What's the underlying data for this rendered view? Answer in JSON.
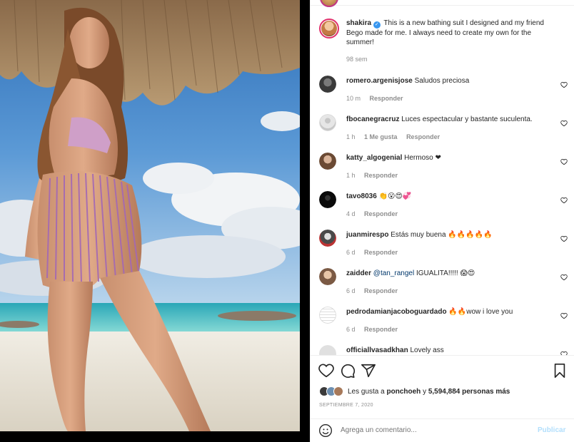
{
  "post": {
    "author": "shakira",
    "caption": "This is a new bathing suit I designed and my friend Bego made for me. I always need to create my own for the summer!",
    "age": "98 sem"
  },
  "comments": [
    {
      "user": "romero.argenisjose",
      "text": "Saludos preciosa",
      "time": "10 m",
      "likes": "",
      "reply": "Responder"
    },
    {
      "user": "fbocanegracruz",
      "text": "Luces espectacular y bastante suculenta.",
      "time": "1 h",
      "likes": "1 Me gusta",
      "reply": "Responder"
    },
    {
      "user": "katty_algogenial",
      "text": "Hermoso ❤",
      "time": "1 h",
      "likes": "",
      "reply": "Responder"
    },
    {
      "user": "tavo8036",
      "text": "👏😮😍💞",
      "time": "4 d",
      "likes": "",
      "reply": "Responder"
    },
    {
      "user": "juanmirespo",
      "text": "Estás muy buena 🔥🔥🔥🔥🔥",
      "time": "6 d",
      "likes": "",
      "reply": "Responder"
    },
    {
      "user": "zaidder",
      "mention": "@tan_rangel",
      "text": " IGUALITA!!!!! 😱😍",
      "time": "6 d",
      "likes": "",
      "reply": "Responder"
    },
    {
      "user": "pedrodamianjacoboguardado",
      "text": "🔥🔥wow i love you",
      "time": "6 d",
      "likes": "",
      "reply": "Responder"
    },
    {
      "user": "officiallvasadkhan",
      "text": "Lovely ass",
      "time": "",
      "likes": "",
      "reply": ""
    }
  ],
  "actions": {
    "icons": [
      "heart-icon",
      "comment-icon",
      "share-icon",
      "bookmark-icon"
    ],
    "likes_prefix": "Les gusta a",
    "likes_user": "ponchoeh",
    "likes_and": "y",
    "likes_count": "5,594,884 personas más",
    "date": "SEPTIEMBRE 7, 2020"
  },
  "composer": {
    "placeholder": "Agrega un comentario...",
    "post_label": "Publicar"
  },
  "colors": {
    "link": "#00376b",
    "muted": "#8e8e8e",
    "verified": "#3897f0",
    "post_disabled": "#b2dffc"
  }
}
